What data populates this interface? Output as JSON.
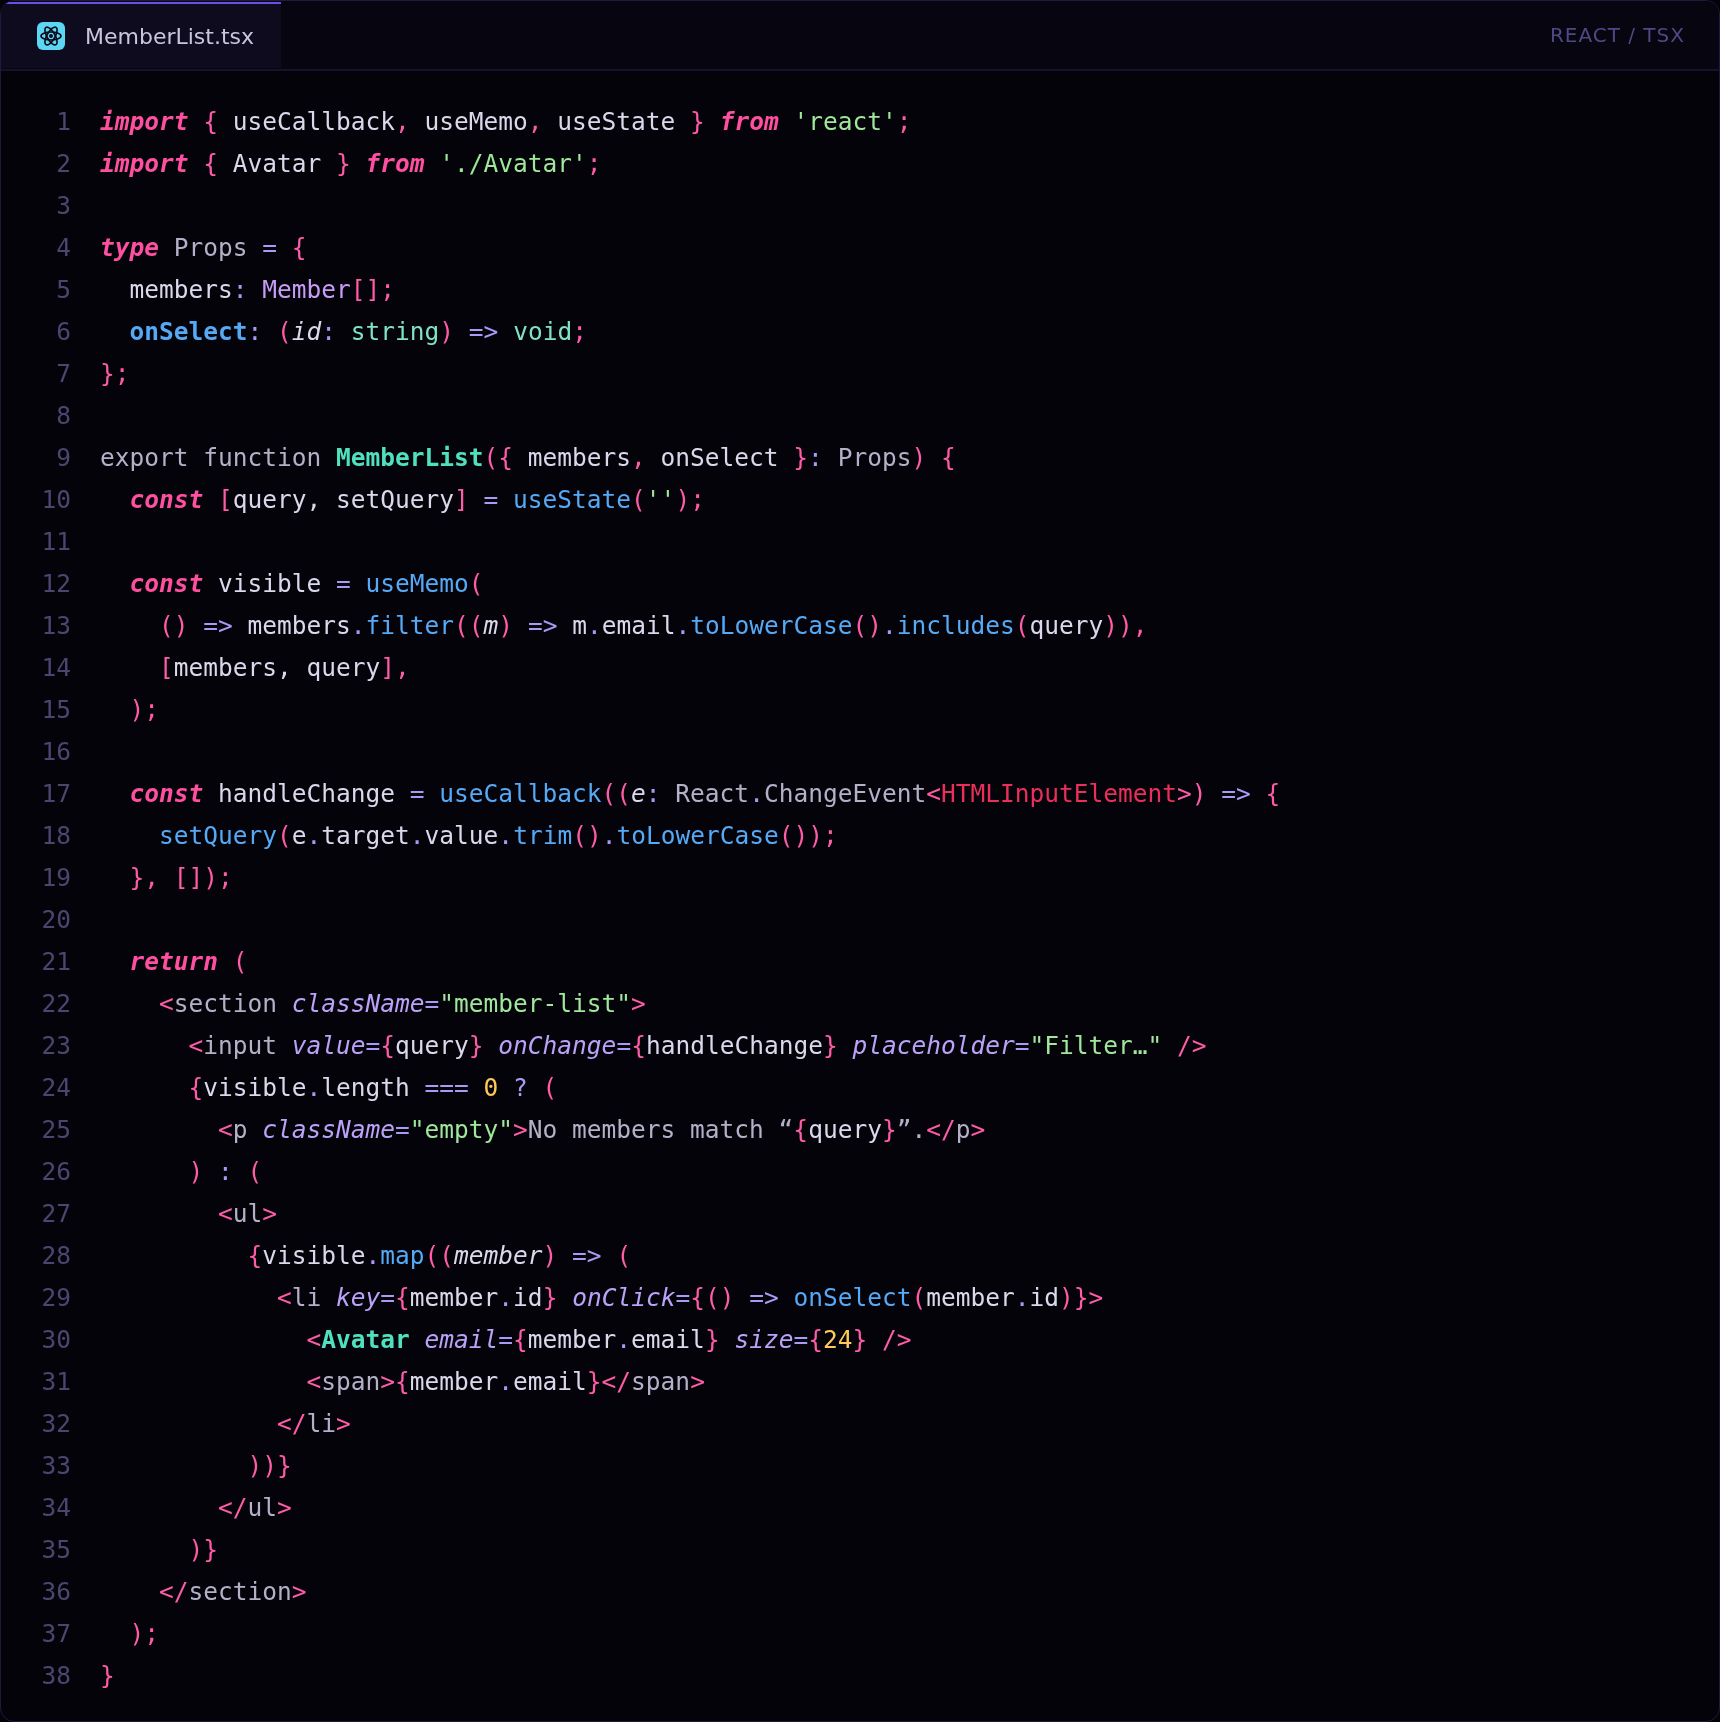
{
  "tab": {
    "title": "MemberList.tsx",
    "selected": true
  },
  "language": "REACT / TSX",
  "lines": [
    {
      "number": "1",
      "tokens": [
        {
          "kind": "keyword",
          "text": "import"
        },
        {
          "kind": "punct",
          "text": " { "
        },
        {
          "kind": "plain",
          "text": "useCallback"
        },
        {
          "kind": "punct",
          "text": ", "
        },
        {
          "kind": "plain",
          "text": "useMemo"
        },
        {
          "kind": "punct",
          "text": ", "
        },
        {
          "kind": "plain",
          "text": "useState"
        },
        {
          "kind": "punct",
          "text": " } "
        },
        {
          "kind": "keyword",
          "text": "from"
        },
        {
          "kind": "string",
          "text": " 'react'"
        },
        {
          "kind": "punct",
          "text": ";"
        }
      ]
    },
    {
      "number": "2",
      "tokens": [
        {
          "kind": "keyword",
          "text": "import"
        },
        {
          "kind": "punct",
          "text": " { "
        },
        {
          "kind": "plain",
          "text": "Avatar"
        },
        {
          "kind": "punct",
          "text": " } "
        },
        {
          "kind": "keyword",
          "text": "from"
        },
        {
          "kind": "string",
          "text": " './Avatar'"
        },
        {
          "kind": "punct",
          "text": ";"
        }
      ]
    },
    {
      "number": "3"
    },
    {
      "number": "4",
      "tokens": [
        {
          "kind": "keyword",
          "text": "type"
        },
        {
          "kind": "muted",
          "text": " Props "
        },
        {
          "kind": "operator",
          "text": "="
        },
        {
          "kind": "punct",
          "text": " {"
        }
      ]
    },
    {
      "number": "5",
      "tokens": [
        {
          "kind": "plain",
          "text": "  members"
        },
        {
          "kind": "operator",
          "text": ": "
        },
        {
          "kind": "type",
          "text": "Member"
        },
        {
          "kind": "punct",
          "text": "[];"
        }
      ]
    },
    {
      "number": "6",
      "tokens": [
        {
          "kind": "property",
          "text": "  onSelect"
        },
        {
          "kind": "operator",
          "text": ": "
        },
        {
          "kind": "punct",
          "text": "("
        },
        {
          "kind": "param",
          "text": "id"
        },
        {
          "kind": "operator",
          "text": ": "
        },
        {
          "kind": "builtin",
          "text": "string"
        },
        {
          "kind": "punct",
          "text": ")"
        },
        {
          "kind": "operator",
          "text": " => "
        },
        {
          "kind": "builtin",
          "text": "void"
        },
        {
          "kind": "punct",
          "text": ";"
        }
      ]
    },
    {
      "number": "7",
      "tokens": [
        {
          "kind": "punct",
          "text": "};"
        }
      ]
    },
    {
      "number": "8"
    },
    {
      "number": "9",
      "tokens": [
        {
          "kind": "muted",
          "text": "export function "
        },
        {
          "kind": "definition",
          "text": "MemberList"
        },
        {
          "kind": "punct",
          "text": "({ "
        },
        {
          "kind": "plain",
          "text": "members"
        },
        {
          "kind": "punct",
          "text": ", "
        },
        {
          "kind": "plain",
          "text": "onSelect"
        },
        {
          "kind": "punct",
          "text": " }"
        },
        {
          "kind": "operator",
          "text": ": "
        },
        {
          "kind": "muted",
          "text": "Props"
        },
        {
          "kind": "punct",
          "text": ") {"
        }
      ]
    },
    {
      "number": "10",
      "tokens": [
        {
          "kind": "keyword",
          "text": "  const"
        },
        {
          "kind": "punct",
          "text": " ["
        },
        {
          "kind": "plain",
          "text": "query, setQuery"
        },
        {
          "kind": "punct",
          "text": "]"
        },
        {
          "kind": "operator",
          "text": " = "
        },
        {
          "kind": "function",
          "text": "useState"
        },
        {
          "kind": "punct",
          "text": "("
        },
        {
          "kind": "string",
          "text": "''"
        },
        {
          "kind": "punct",
          "text": ");"
        }
      ]
    },
    {
      "number": "11"
    },
    {
      "number": "12",
      "tokens": [
        {
          "kind": "keyword",
          "text": "  const"
        },
        {
          "kind": "plain",
          "text": " visible "
        },
        {
          "kind": "operator",
          "text": "= "
        },
        {
          "kind": "function",
          "text": "useMemo"
        },
        {
          "kind": "punct",
          "text": "("
        }
      ]
    },
    {
      "number": "13",
      "tokens": [
        {
          "kind": "punct",
          "text": "    () "
        },
        {
          "kind": "operator",
          "text": "=> "
        },
        {
          "kind": "plain",
          "text": "members"
        },
        {
          "kind": "operator",
          "text": "."
        },
        {
          "kind": "function",
          "text": "filter"
        },
        {
          "kind": "punct",
          "text": "(("
        },
        {
          "kind": "param",
          "text": "m"
        },
        {
          "kind": "punct",
          "text": ") "
        },
        {
          "kind": "operator",
          "text": "=> "
        },
        {
          "kind": "plain",
          "text": "m"
        },
        {
          "kind": "operator",
          "text": "."
        },
        {
          "kind": "plain",
          "text": "email"
        },
        {
          "kind": "operator",
          "text": "."
        },
        {
          "kind": "function",
          "text": "toLowerCase"
        },
        {
          "kind": "punct",
          "text": "()"
        },
        {
          "kind": "operator",
          "text": "."
        },
        {
          "kind": "function",
          "text": "includes"
        },
        {
          "kind": "punct",
          "text": "("
        },
        {
          "kind": "plain",
          "text": "query"
        },
        {
          "kind": "punct",
          "text": ")),"
        }
      ]
    },
    {
      "number": "14",
      "tokens": [
        {
          "kind": "punct",
          "text": "    ["
        },
        {
          "kind": "plain",
          "text": "members, query"
        },
        {
          "kind": "punct",
          "text": "],"
        }
      ]
    },
    {
      "number": "15",
      "tokens": [
        {
          "kind": "punct",
          "text": "  );"
        }
      ]
    },
    {
      "number": "16"
    },
    {
      "number": "17",
      "tokens": [
        {
          "kind": "keyword",
          "text": "  const"
        },
        {
          "kind": "plain",
          "text": " handleChange "
        },
        {
          "kind": "operator",
          "text": "= "
        },
        {
          "kind": "function",
          "text": "useCallback"
        },
        {
          "kind": "punct",
          "text": "(("
        },
        {
          "kind": "param",
          "text": "e"
        },
        {
          "kind": "operator",
          "text": ": "
        },
        {
          "kind": "muted",
          "text": "React"
        },
        {
          "kind": "operator",
          "text": "."
        },
        {
          "kind": "muted",
          "text": "ChangeEvent"
        },
        {
          "kind": "punct",
          "text": "<"
        },
        {
          "kind": "error",
          "text": "HTMLInputElement"
        },
        {
          "kind": "punct",
          "text": ">) "
        },
        {
          "kind": "operator",
          "text": "=> "
        },
        {
          "kind": "punct",
          "text": "{"
        }
      ]
    },
    {
      "number": "18",
      "tokens": [
        {
          "kind": "function",
          "text": "    setQuery"
        },
        {
          "kind": "punct",
          "text": "("
        },
        {
          "kind": "plain",
          "text": "e"
        },
        {
          "kind": "operator",
          "text": "."
        },
        {
          "kind": "plain",
          "text": "target"
        },
        {
          "kind": "operator",
          "text": "."
        },
        {
          "kind": "plain",
          "text": "value"
        },
        {
          "kind": "operator",
          "text": "."
        },
        {
          "kind": "function",
          "text": "trim"
        },
        {
          "kind": "punct",
          "text": "()"
        },
        {
          "kind": "operator",
          "text": "."
        },
        {
          "kind": "function",
          "text": "toLowerCase"
        },
        {
          "kind": "punct",
          "text": "());"
        }
      ]
    },
    {
      "number": "19",
      "tokens": [
        {
          "kind": "punct",
          "text": "  }, []);"
        }
      ]
    },
    {
      "number": "20"
    },
    {
      "number": "21",
      "tokens": [
        {
          "kind": "keyword",
          "text": "  return"
        },
        {
          "kind": "punct",
          "text": " ("
        }
      ]
    },
    {
      "number": "22",
      "tokens": [
        {
          "kind": "punct",
          "text": "    <"
        },
        {
          "kind": "muted",
          "text": "section"
        },
        {
          "kind": "attribute",
          "text": " className"
        },
        {
          "kind": "operator",
          "text": "="
        },
        {
          "kind": "string",
          "text": "\"member-list\""
        },
        {
          "kind": "punct",
          "text": ">"
        }
      ]
    },
    {
      "number": "23",
      "tokens": [
        {
          "kind": "punct",
          "text": "      <"
        },
        {
          "kind": "muted",
          "text": "input"
        },
        {
          "kind": "attribute",
          "text": " value"
        },
        {
          "kind": "operator",
          "text": "="
        },
        {
          "kind": "punct",
          "text": "{"
        },
        {
          "kind": "plain",
          "text": "query"
        },
        {
          "kind": "punct",
          "text": "}"
        },
        {
          "kind": "attribute",
          "text": " onChange"
        },
        {
          "kind": "operator",
          "text": "="
        },
        {
          "kind": "punct",
          "text": "{"
        },
        {
          "kind": "plain",
          "text": "handleChange"
        },
        {
          "kind": "punct",
          "text": "}"
        },
        {
          "kind": "attribute",
          "text": " placeholder"
        },
        {
          "kind": "operator",
          "text": "="
        },
        {
          "kind": "string",
          "text": "\"Filter…\""
        },
        {
          "kind": "punct",
          "text": " />"
        }
      ]
    },
    {
      "number": "24",
      "tokens": [
        {
          "kind": "punct",
          "text": "      {"
        },
        {
          "kind": "plain",
          "text": "visible"
        },
        {
          "kind": "operator",
          "text": "."
        },
        {
          "kind": "plain",
          "text": "length"
        },
        {
          "kind": "operator",
          "text": " === "
        },
        {
          "kind": "number",
          "text": "0"
        },
        {
          "kind": "operator",
          "text": " ? "
        },
        {
          "kind": "punct",
          "text": "("
        }
      ]
    },
    {
      "number": "25",
      "tokens": [
        {
          "kind": "punct",
          "text": "        <"
        },
        {
          "kind": "muted",
          "text": "p"
        },
        {
          "kind": "attribute",
          "text": " className"
        },
        {
          "kind": "operator",
          "text": "="
        },
        {
          "kind": "string",
          "text": "\"empty\""
        },
        {
          "kind": "punct",
          "text": ">"
        },
        {
          "kind": "muted",
          "text": "No members match “"
        },
        {
          "kind": "punct",
          "text": "{"
        },
        {
          "kind": "plain",
          "text": "query"
        },
        {
          "kind": "punct",
          "text": "}"
        },
        {
          "kind": "muted",
          "text": "”."
        },
        {
          "kind": "punct",
          "text": "</"
        },
        {
          "kind": "muted",
          "text": "p"
        },
        {
          "kind": "punct",
          "text": ">"
        }
      ]
    },
    {
      "number": "26",
      "tokens": [
        {
          "kind": "punct",
          "text": "      ) "
        },
        {
          "kind": "operator",
          "text": ": "
        },
        {
          "kind": "punct",
          "text": "("
        }
      ]
    },
    {
      "number": "27",
      "tokens": [
        {
          "kind": "punct",
          "text": "        <"
        },
        {
          "kind": "muted",
          "text": "ul"
        },
        {
          "kind": "punct",
          "text": ">"
        }
      ]
    },
    {
      "number": "28",
      "tokens": [
        {
          "kind": "punct",
          "text": "          {"
        },
        {
          "kind": "plain",
          "text": "visible"
        },
        {
          "kind": "operator",
          "text": "."
        },
        {
          "kind": "function",
          "text": "map"
        },
        {
          "kind": "punct",
          "text": "(("
        },
        {
          "kind": "param",
          "text": "member"
        },
        {
          "kind": "punct",
          "text": ") "
        },
        {
          "kind": "operator",
          "text": "=> "
        },
        {
          "kind": "punct",
          "text": "("
        }
      ]
    },
    {
      "number": "29",
      "tokens": [
        {
          "kind": "punct",
          "text": "            <"
        },
        {
          "kind": "muted",
          "text": "li"
        },
        {
          "kind": "attribute",
          "text": " key"
        },
        {
          "kind": "operator",
          "text": "="
        },
        {
          "kind": "punct",
          "text": "{"
        },
        {
          "kind": "plain",
          "text": "member"
        },
        {
          "kind": "operator",
          "text": "."
        },
        {
          "kind": "plain",
          "text": "id"
        },
        {
          "kind": "punct",
          "text": "}"
        },
        {
          "kind": "attribute",
          "text": " onClick"
        },
        {
          "kind": "operator",
          "text": "="
        },
        {
          "kind": "punct",
          "text": "{() "
        },
        {
          "kind": "operator",
          "text": "=> "
        },
        {
          "kind": "function",
          "text": "onSelect"
        },
        {
          "kind": "punct",
          "text": "("
        },
        {
          "kind": "plain",
          "text": "member"
        },
        {
          "kind": "operator",
          "text": "."
        },
        {
          "kind": "plain",
          "text": "id"
        },
        {
          "kind": "punct",
          "text": ")}>"
        }
      ]
    },
    {
      "number": "30",
      "tokens": [
        {
          "kind": "punct",
          "text": "              <"
        },
        {
          "kind": "definition",
          "text": "Avatar"
        },
        {
          "kind": "attribute",
          "text": " email"
        },
        {
          "kind": "operator",
          "text": "="
        },
        {
          "kind": "punct",
          "text": "{"
        },
        {
          "kind": "plain",
          "text": "member"
        },
        {
          "kind": "operator",
          "text": "."
        },
        {
          "kind": "plain",
          "text": "email"
        },
        {
          "kind": "punct",
          "text": "}"
        },
        {
          "kind": "attribute",
          "text": " size"
        },
        {
          "kind": "operator",
          "text": "="
        },
        {
          "kind": "punct",
          "text": "{"
        },
        {
          "kind": "number",
          "text": "24"
        },
        {
          "kind": "punct",
          "text": "} />"
        }
      ]
    },
    {
      "number": "31",
      "tokens": [
        {
          "kind": "punct",
          "text": "              <"
        },
        {
          "kind": "muted",
          "text": "span"
        },
        {
          "kind": "punct",
          "text": ">{"
        },
        {
          "kind": "plain",
          "text": "member"
        },
        {
          "kind": "operator",
          "text": "."
        },
        {
          "kind": "plain",
          "text": "email"
        },
        {
          "kind": "punct",
          "text": "}</"
        },
        {
          "kind": "muted",
          "text": "span"
        },
        {
          "kind": "punct",
          "text": ">"
        }
      ]
    },
    {
      "number": "32",
      "tokens": [
        {
          "kind": "punct",
          "text": "            </"
        },
        {
          "kind": "muted",
          "text": "li"
        },
        {
          "kind": "punct",
          "text": ">"
        }
      ]
    },
    {
      "number": "33",
      "tokens": [
        {
          "kind": "punct",
          "text": "          ))}"
        }
      ]
    },
    {
      "number": "34",
      "tokens": [
        {
          "kind": "punct",
          "text": "        </"
        },
        {
          "kind": "muted",
          "text": "ul"
        },
        {
          "kind": "punct",
          "text": ">"
        }
      ]
    },
    {
      "number": "35",
      "tokens": [
        {
          "kind": "punct",
          "text": "      )}"
        }
      ]
    },
    {
      "number": "36",
      "tokens": [
        {
          "kind": "punct",
          "text": "    </"
        },
        {
          "kind": "muted",
          "text": "section"
        },
        {
          "kind": "punct",
          "text": ">"
        }
      ]
    },
    {
      "number": "37",
      "tokens": [
        {
          "kind": "punct",
          "text": "  );"
        }
      ]
    },
    {
      "number": "38",
      "tokens": [
        {
          "kind": "punct",
          "text": "}"
        }
      ]
    }
  ]
}
